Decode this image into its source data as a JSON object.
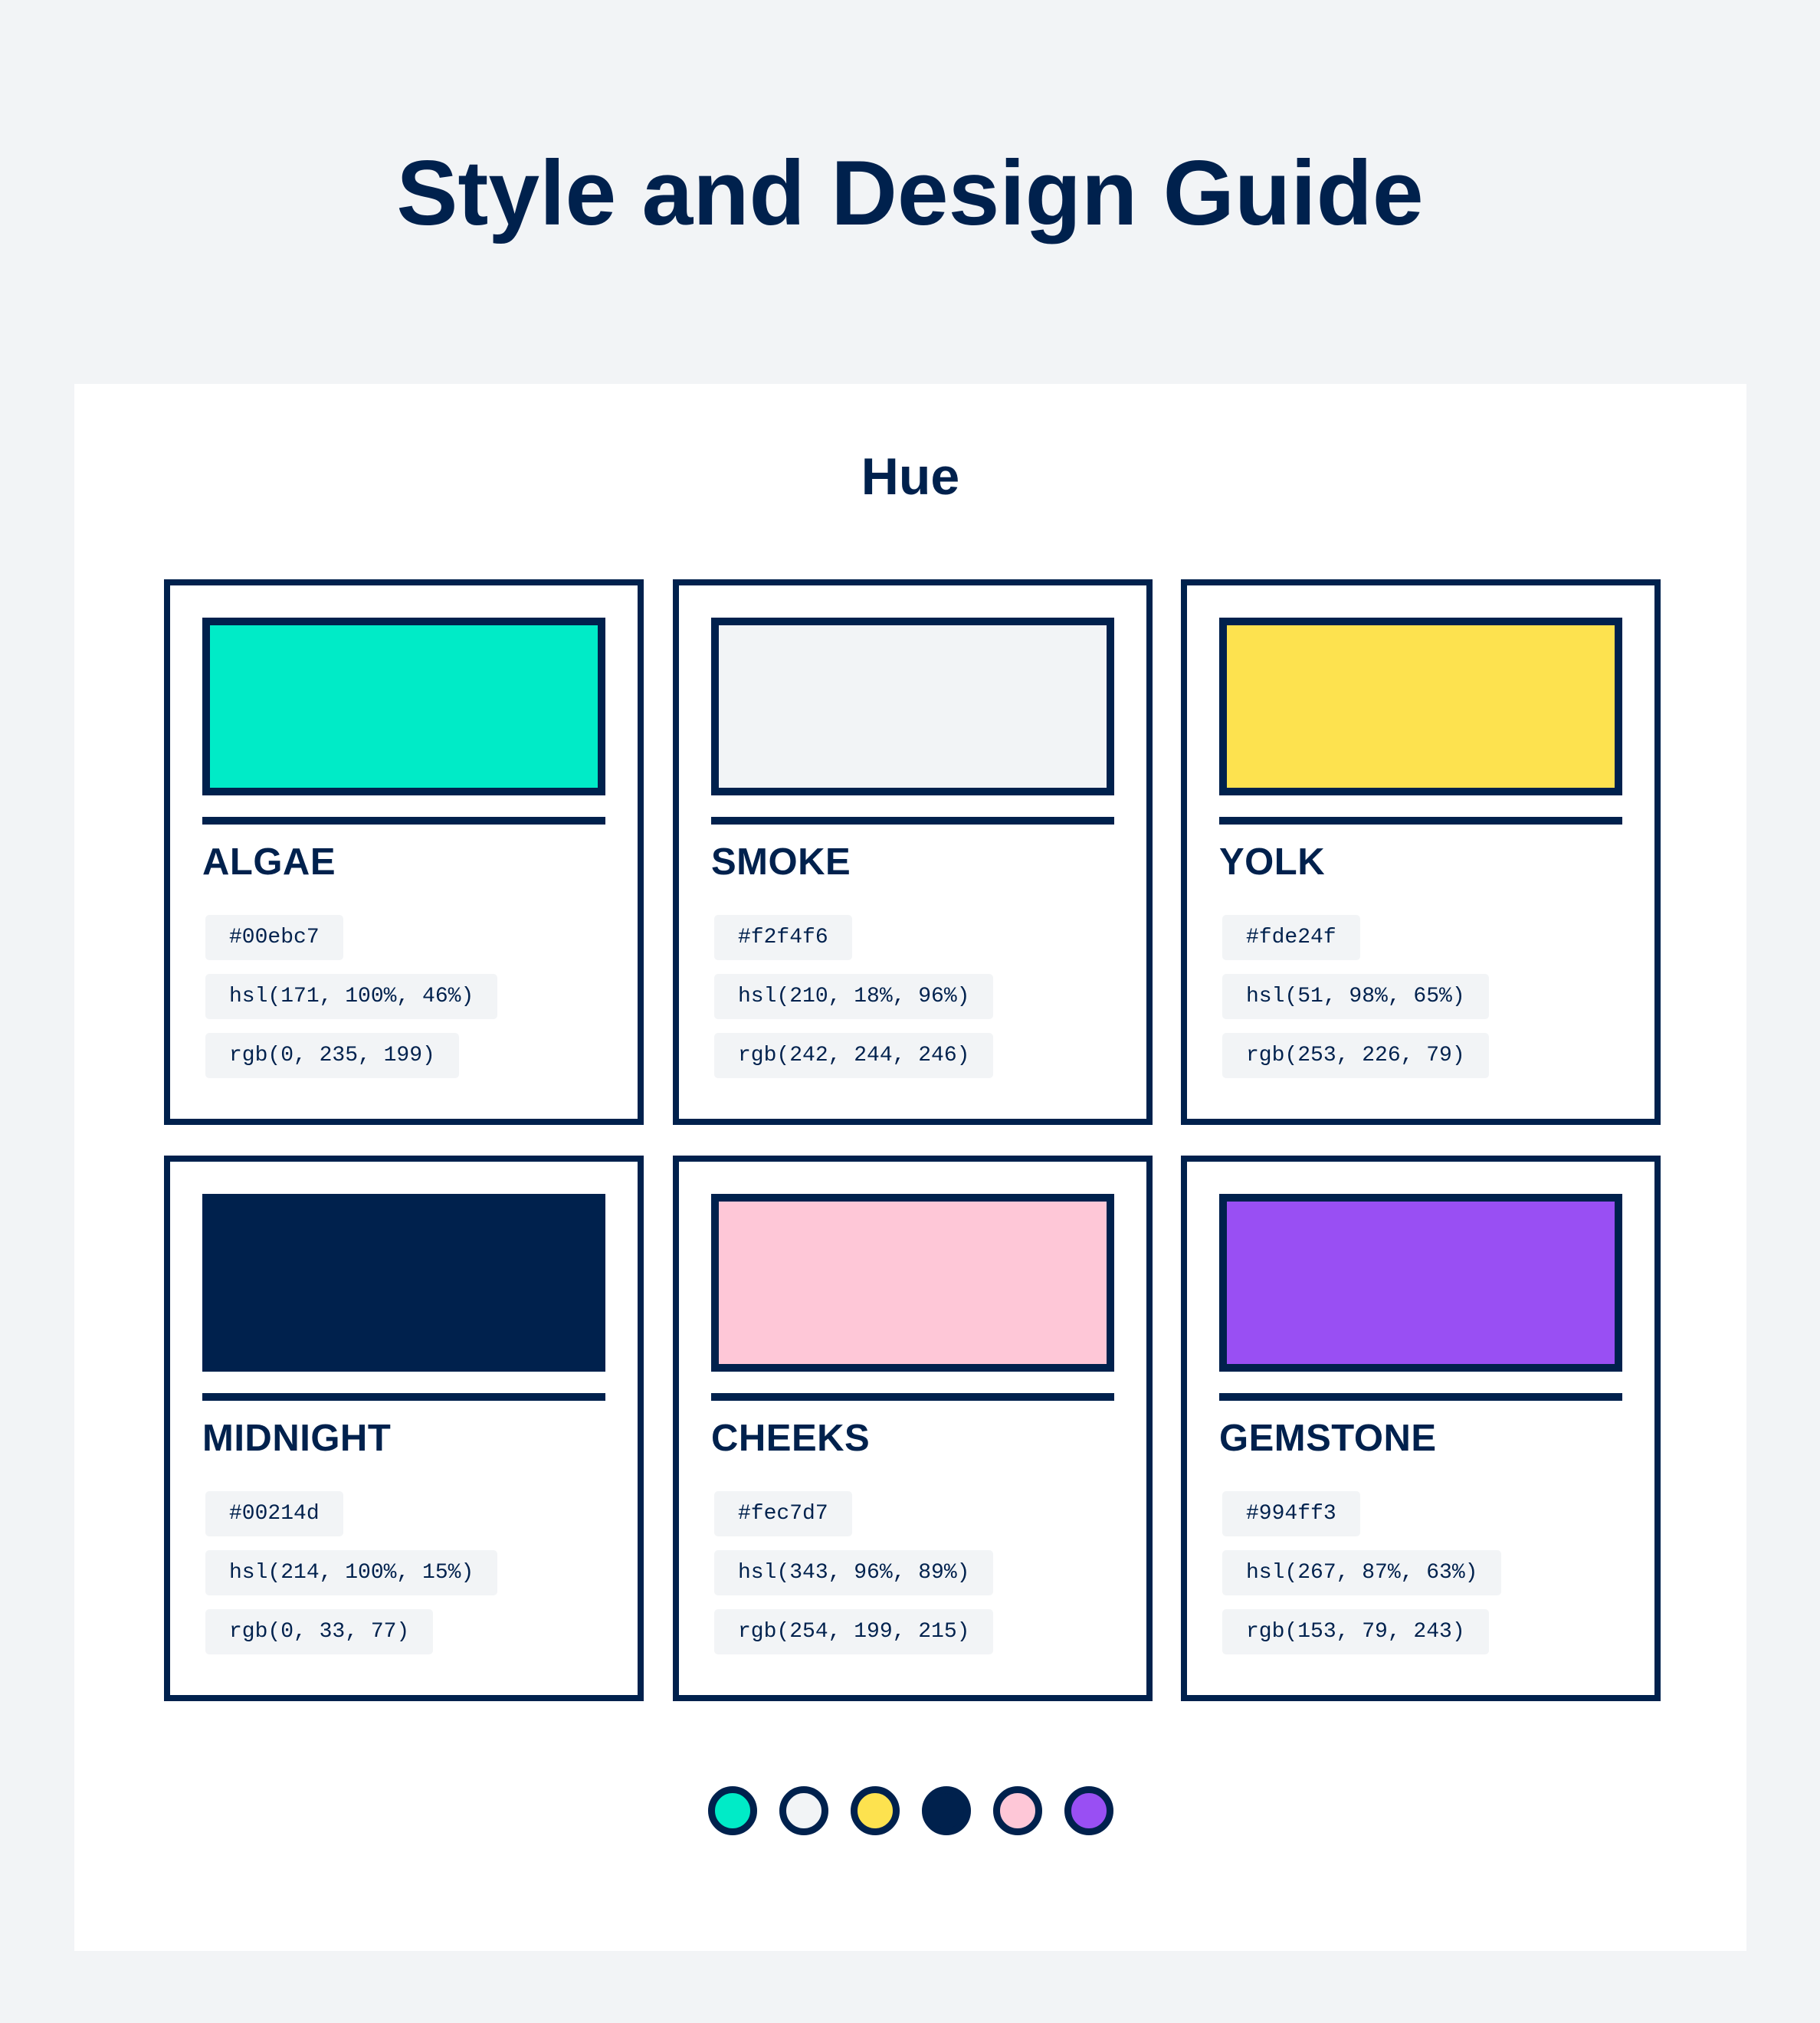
{
  "page": {
    "title": "Style and Design Guide"
  },
  "section": {
    "title": "Hue"
  },
  "colors": [
    {
      "name": "ALGAE",
      "hex": "#00ebc7",
      "hsl": "hsl(171, 100%, 46%)",
      "rgb": "rgb(0, 235, 199)",
      "swatch": "#00ebc7"
    },
    {
      "name": "SMOKE",
      "hex": "#f2f4f6",
      "hsl": "hsl(210, 18%, 96%)",
      "rgb": "rgb(242, 244, 246)",
      "swatch": "#f2f4f6"
    },
    {
      "name": "YOLK",
      "hex": "#fde24f",
      "hsl": "hsl(51, 98%, 65%)",
      "rgb": "rgb(253, 226, 79)",
      "swatch": "#fde24f"
    },
    {
      "name": "MIDNIGHT",
      "hex": "#00214d",
      "hsl": "hsl(214, 100%, 15%)",
      "rgb": "rgb(0, 33, 77)",
      "swatch": "#00214d"
    },
    {
      "name": "CHEEKS",
      "hex": "#fec7d7",
      "hsl": "hsl(343, 96%, 89%)",
      "rgb": "rgb(254, 199, 215)",
      "swatch": "#fec7d7"
    },
    {
      "name": "GEMSTONE",
      "hex": "#994ff3",
      "hsl": "hsl(267, 87%, 63%)",
      "rgb": "rgb(153, 79, 243)",
      "swatch": "#994ff3"
    }
  ],
  "theme": {
    "page_background": "#f2f4f6",
    "panel_background": "#ffffff",
    "ink": "#00214d",
    "chip_background": "#f2f4f6"
  }
}
